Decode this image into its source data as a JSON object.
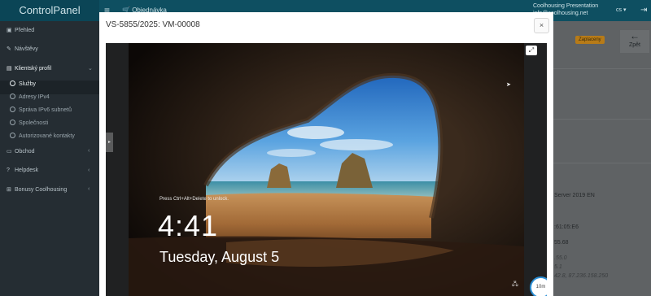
{
  "app": {
    "brand": "ControlPanel",
    "menu_icon": "menu-icon",
    "orders_label": "Objednávka",
    "user_name": "Coolhousing Presentation",
    "user_email": "info@coolhousing.net",
    "language": "cs",
    "logout_icon": "logout-icon",
    "back_label": "Zpět",
    "payment_badge": "Zaplaceny"
  },
  "sidebar": {
    "items": [
      {
        "label": "Přehled",
        "icon": "dashboard-icon"
      },
      {
        "label": "Návštěvy",
        "icon": "wrench-icon"
      },
      {
        "label": "Klientský profil",
        "icon": "profile-icon",
        "expanded": true
      },
      {
        "label": "Obchod",
        "icon": "cart-icon"
      },
      {
        "label": "Helpdesk",
        "icon": "help-icon"
      },
      {
        "label": "Bonusy Coolhousing",
        "icon": "gift-icon"
      }
    ],
    "subitems": [
      {
        "label": "Služby",
        "active": true
      },
      {
        "label": "Adresy IPv4"
      },
      {
        "label": "Správa IPv6 subnetů"
      },
      {
        "label": "Společnosti"
      },
      {
        "label": "Autorizované kontakty"
      }
    ]
  },
  "background_details": {
    "os": "Server 2019 EN",
    "mac": ":61:05:E6",
    "ip1": "55.68",
    "ip2": ".55.0",
    "ip3": "5.1",
    "ip4": "42.8, 87.236.158.250"
  },
  "modal": {
    "title": "VS-5855/2025: VM-00008",
    "close_label": "×",
    "expand_icon": "⤢",
    "lock_hint": "Press Ctrl+Alt+Delete to unlock.",
    "lock_time": "4:41",
    "lock_date": "Tuesday, August 5",
    "session_timer": "10m",
    "side_toggle": "▸",
    "net_icon": "network-icon"
  },
  "colors": {
    "header": "#0e4f61",
    "sidebar": "#252d33",
    "accent_timer": "#2a8fd6",
    "badge": "#b77b18"
  }
}
